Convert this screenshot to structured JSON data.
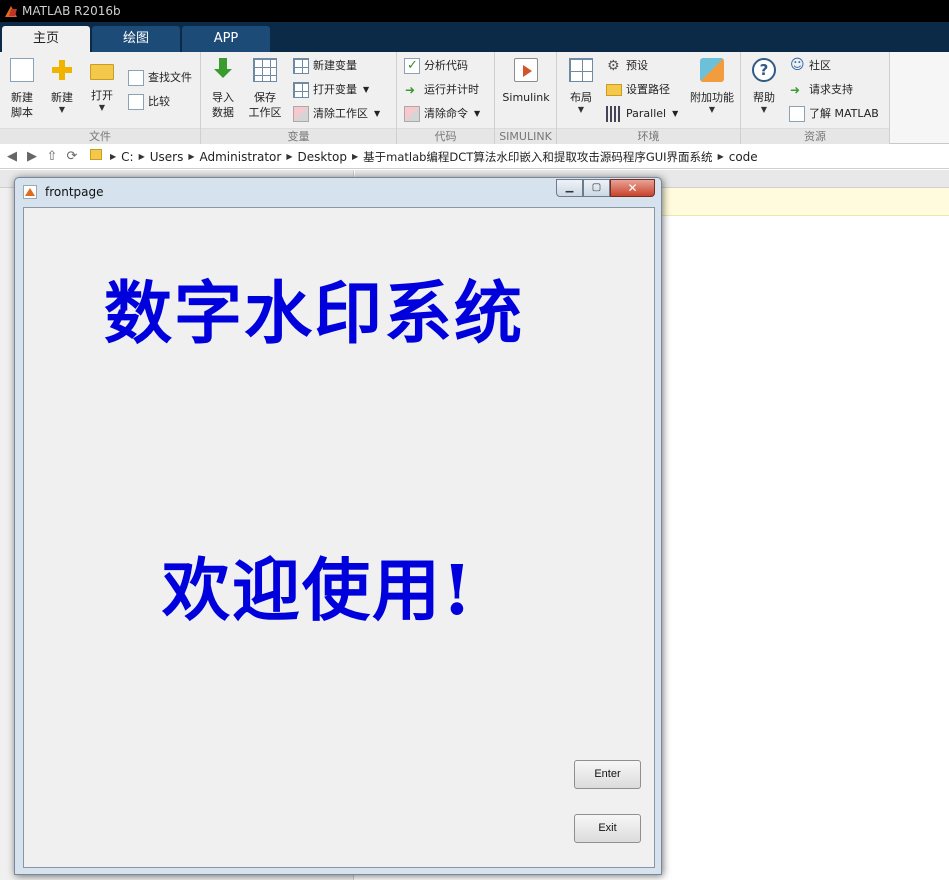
{
  "app": {
    "title": "MATLAB R2016b"
  },
  "tabs": [
    {
      "label": "主页",
      "active": true
    },
    {
      "label": "绘图",
      "active": false
    },
    {
      "label": "APP",
      "active": false
    }
  ],
  "toolstrip": {
    "file": {
      "label": "文件",
      "new_script": "新建\n脚本",
      "new": "新建",
      "open": "打开",
      "find_files": "查找文件",
      "compare": "比较"
    },
    "variable": {
      "label": "变量",
      "import_data": "导入\n数据",
      "save_workspace": "保存\n工作区",
      "new_variable": "新建变量",
      "open_variable": "打开变量",
      "clear_workspace": "清除工作区"
    },
    "code": {
      "label": "代码",
      "analyze_code": "分析代码",
      "run_and_time": "运行并计时",
      "clear_commands": "清除命令"
    },
    "simulink": {
      "label": "SIMULINK",
      "simulink": "Simulink"
    },
    "environment": {
      "label": "环境",
      "layout": "布局",
      "preferences": "预设",
      "set_path": "设置路径",
      "parallel": "Parallel",
      "add_ons": "附加功能"
    },
    "resources": {
      "label": "资源",
      "help": "帮助",
      "community": "社区",
      "request_support": "请求支持",
      "learn_matlab": "了解 MATLAB"
    }
  },
  "addressbar": {
    "path": [
      "C:",
      "Users",
      "Administrator",
      "Desktop",
      "基于matlab编程DCT算法水印嵌入和提取攻击源码程序GUI界面系统",
      "code"
    ]
  },
  "figure": {
    "window_title": "frontpage",
    "title_text": "数字水印系统",
    "welcome_text": "欢迎使用!",
    "enter_label": "Enter",
    "exit_label": "Exit",
    "text_color": "#0000dd"
  }
}
